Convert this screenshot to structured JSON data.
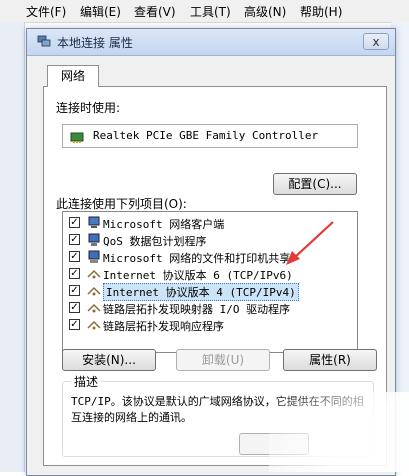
{
  "background_window": {
    "menu": [
      "文件(F)",
      "编辑(E)",
      "查看(V)",
      "工具(T)",
      "高级(N)",
      "帮助(H)"
    ]
  },
  "dialog": {
    "title": "本地连接 属性",
    "close_glyph": "x",
    "tab_label": "网络",
    "connect_using_label": "连接时使用:",
    "adapter_name": "Realtek PCIe GBE Family Controller",
    "configure_button": "配置(C)...",
    "items_label": "此连接使用下列项目(O):",
    "items": [
      {
        "label": "Microsoft 网络客户端",
        "checked": true,
        "icon": "network-client-icon"
      },
      {
        "label": "QoS 数据包计划程序",
        "checked": true,
        "icon": "qos-icon"
      },
      {
        "label": "Microsoft 网络的文件和打印机共享",
        "checked": true,
        "icon": "file-printer-share-icon"
      },
      {
        "label": "Internet 协议版本 6 (TCP/IPv6)",
        "checked": true,
        "icon": "protocol-icon"
      },
      {
        "label": "Internet 协议版本 4 (TCP/IPv4)",
        "checked": true,
        "icon": "protocol-icon",
        "selected": true
      },
      {
        "label": "链路层拓扑发现映射器 I/O 驱动程序",
        "checked": true,
        "icon": "protocol-icon"
      },
      {
        "label": "链路层拓扑发现响应程序",
        "checked": true,
        "icon": "protocol-icon"
      }
    ],
    "install_button": "安装(N)...",
    "uninstall_button": "卸载(U)",
    "properties_button": "属性(R)",
    "description_title": "描述",
    "description_text": "TCP/IP。该协议是默认的广域网络协议，它提供在不同的相互连接的网络上的通讯。",
    "check_glyph": "✓",
    "colors": {
      "arrow": "#e53935",
      "selection": "#cce4f7"
    }
  }
}
